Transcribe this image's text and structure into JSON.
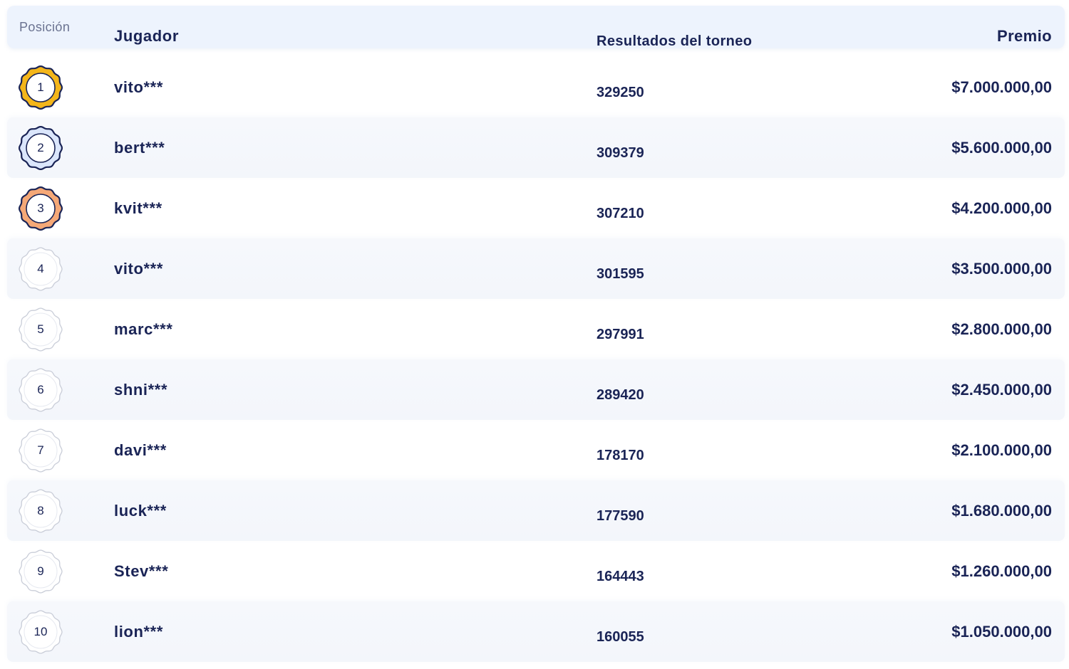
{
  "header": {
    "position": "Posición",
    "player": "Jugador",
    "results": "Resultados del torneo",
    "prize": "Premio"
  },
  "colors": {
    "gold": "#f4b61a",
    "silver": "#dbe6fb",
    "bronze": "#f5a877",
    "ink": "#1a2456"
  },
  "rows": [
    {
      "position": "1",
      "badge": "gold-medal-icon",
      "player": "vito***",
      "result": "329250",
      "prize": "$7.000.000,00"
    },
    {
      "position": "2",
      "badge": "silver-medal-icon",
      "player": "bert***",
      "result": "309379",
      "prize": "$5.600.000,00"
    },
    {
      "position": "3",
      "badge": "bronze-medal-icon",
      "player": "kvit***",
      "result": "307210",
      "prize": "$4.200.000,00"
    },
    {
      "position": "4",
      "badge": "plain-medal-icon",
      "player": "vito***",
      "result": "301595",
      "prize": "$3.500.000,00"
    },
    {
      "position": "5",
      "badge": "plain-medal-icon",
      "player": "marc***",
      "result": "297991",
      "prize": "$2.800.000,00"
    },
    {
      "position": "6",
      "badge": "plain-medal-icon",
      "player": "shni***",
      "result": "289420",
      "prize": "$2.450.000,00"
    },
    {
      "position": "7",
      "badge": "plain-medal-icon",
      "player": "davi***",
      "result": "178170",
      "prize": "$2.100.000,00"
    },
    {
      "position": "8",
      "badge": "plain-medal-icon",
      "player": "luck***",
      "result": "177590",
      "prize": "$1.680.000,00"
    },
    {
      "position": "9",
      "badge": "plain-medal-icon",
      "player": "Stev***",
      "result": "164443",
      "prize": "$1.260.000,00"
    },
    {
      "position": "10",
      "badge": "plain-medal-icon",
      "player": "lion***",
      "result": "160055",
      "prize": "$1.050.000,00"
    }
  ]
}
